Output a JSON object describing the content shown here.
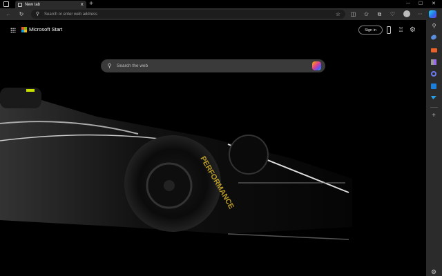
{
  "browser": {
    "tab_title": "New tab",
    "address_placeholder": "Search or enter web address",
    "new_tab": "+",
    "close_tab": "×",
    "more": "···"
  },
  "window": {
    "minimize": "—",
    "maximize": "☐",
    "close": "✕"
  },
  "page": {
    "brand": "Microsoft Start",
    "sign_in": "Sign in",
    "search_placeholder": "Search the web",
    "tire_text": "PERFORMANCE"
  },
  "sidebar": {
    "add": "+"
  }
}
